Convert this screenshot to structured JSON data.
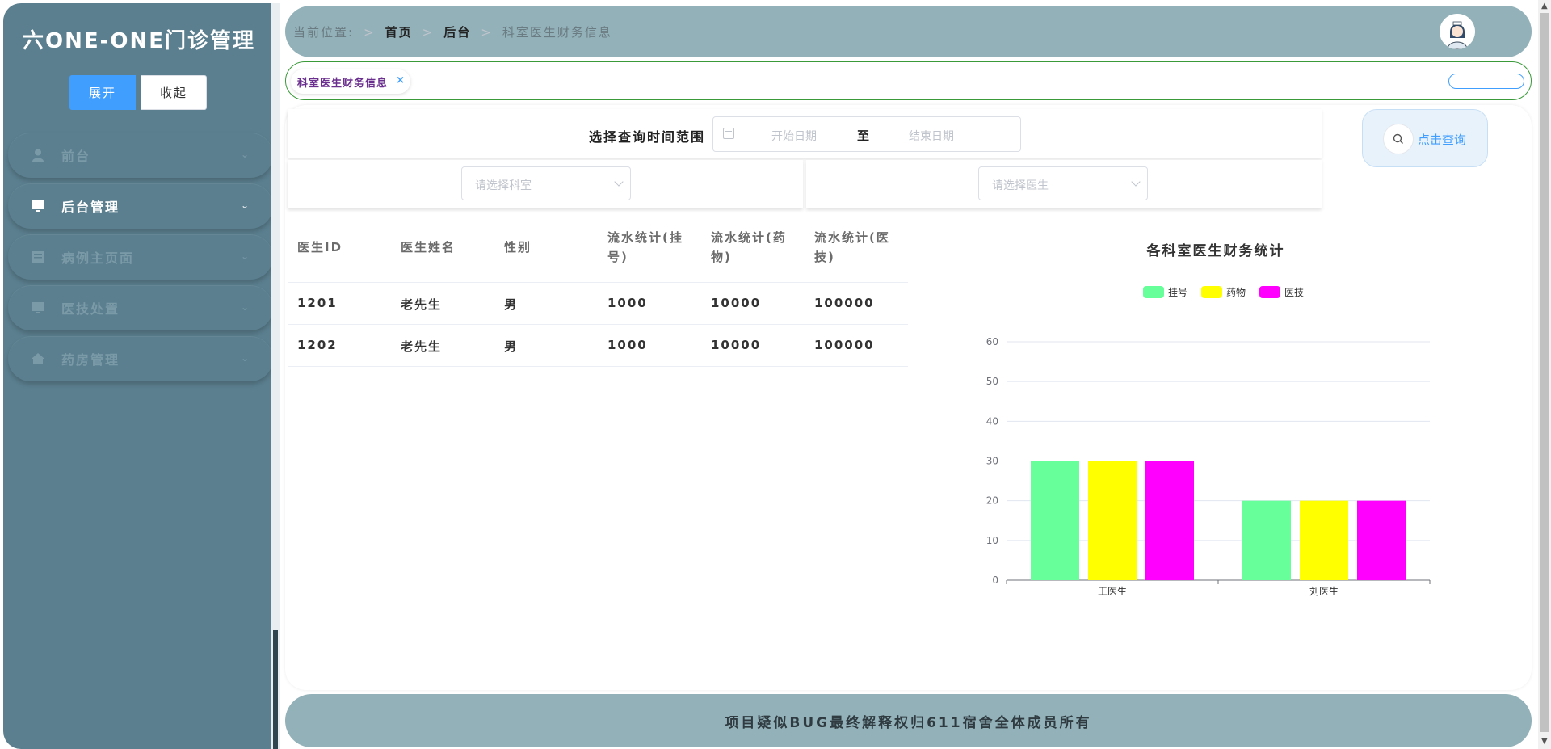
{
  "app": {
    "brand": "六ONE-ONE门诊管理"
  },
  "sidebar": {
    "expand_label": "展开",
    "collapse_label": "收起",
    "items": [
      {
        "label": "前台",
        "icon": "user-icon",
        "active": false
      },
      {
        "label": "后台管理",
        "icon": "monitor-icon",
        "active": true
      },
      {
        "label": "病例主页面",
        "icon": "grid-icon",
        "active": false
      },
      {
        "label": "医技处置",
        "icon": "monitor-icon",
        "active": false
      },
      {
        "label": "药房管理",
        "icon": "home-icon",
        "active": false
      }
    ]
  },
  "header": {
    "crumb_prefix": "当前位置:",
    "crumbs": [
      "首页",
      "后台",
      "科室医生财务信息"
    ],
    "separator": ">"
  },
  "tabs": {
    "active_label": "科室医生财务信息",
    "close_symbol": "×"
  },
  "filters": {
    "time_label": "选择查询时间范围",
    "start_placeholder": "开始日期",
    "range_separator": "至",
    "end_placeholder": "结束日期",
    "department_placeholder": "请选择科室",
    "doctor_placeholder": "请选择医生",
    "search_label": "点击查询"
  },
  "table": {
    "columns": [
      "医生ID",
      "医生姓名",
      "性别",
      "流水统计(挂号)",
      "流水统计(药物)",
      "流水统计(医技)"
    ],
    "rows": [
      [
        "1201",
        "老先生",
        "男",
        "1000",
        "10000",
        "100000"
      ],
      [
        "1202",
        "老先生",
        "男",
        "1000",
        "10000",
        "100000"
      ]
    ]
  },
  "chart_data": {
    "type": "bar",
    "title": "各科室医生财务统计",
    "categories": [
      "王医生",
      "刘医生"
    ],
    "series": [
      {
        "name": "挂号",
        "color": "#66ff99",
        "values": [
          30,
          20
        ]
      },
      {
        "name": "药物",
        "color": "#ffff00",
        "values": [
          30,
          20
        ]
      },
      {
        "name": "医技",
        "color": "#ff00ff",
        "values": [
          30,
          20
        ]
      }
    ],
    "yticks": [
      0,
      10,
      20,
      30,
      40,
      50,
      60
    ],
    "ylim": [
      0,
      60
    ],
    "legend_position": "top-center",
    "grid": true
  },
  "footer": {
    "text": "项目疑似BUG最终解释权归611宿舍全体成员所有"
  }
}
